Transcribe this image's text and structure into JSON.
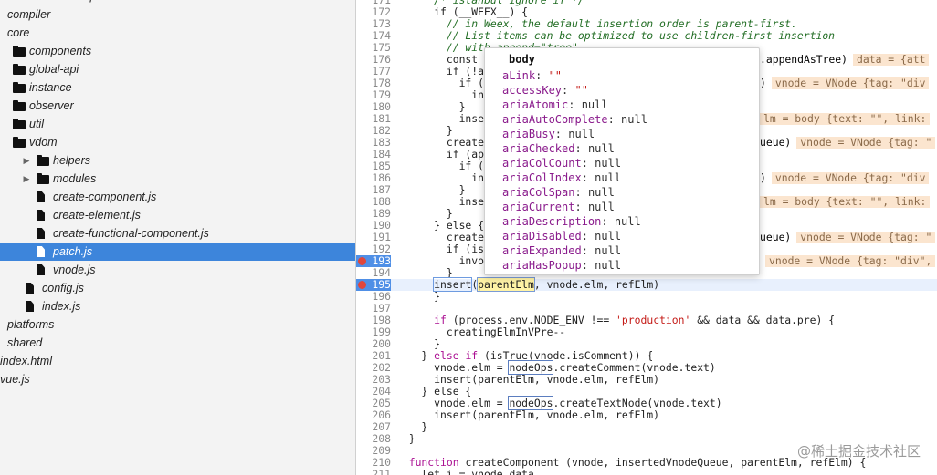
{
  "sidebar": {
    "items": [
      {
        "label": "Users/tian/Desktop/read-source/vue/src",
        "type": "root",
        "depth": 0
      },
      {
        "label": "compiler",
        "type": "folder",
        "depth": 0
      },
      {
        "label": "core",
        "type": "folder-open",
        "depth": 0
      },
      {
        "label": "components",
        "type": "folder",
        "depth": 1
      },
      {
        "label": "global-api",
        "type": "folder",
        "depth": 1
      },
      {
        "label": "instance",
        "type": "folder",
        "depth": 1
      },
      {
        "label": "observer",
        "type": "folder",
        "depth": 1
      },
      {
        "label": "util",
        "type": "folder",
        "depth": 1
      },
      {
        "label": "vdom",
        "type": "folder",
        "depth": 1
      },
      {
        "label": "helpers",
        "type": "folder-collapsed",
        "depth": 2
      },
      {
        "label": "modules",
        "type": "folder-collapsed",
        "depth": 2
      },
      {
        "label": "create-component.js",
        "type": "file",
        "depth": 2
      },
      {
        "label": "create-element.js",
        "type": "file",
        "depth": 2
      },
      {
        "label": "create-functional-component.js",
        "type": "file",
        "depth": 2
      },
      {
        "label": "patch.js",
        "type": "file",
        "depth": 2,
        "selected": true
      },
      {
        "label": "vnode.js",
        "type": "file",
        "depth": 2
      },
      {
        "label": "config.js",
        "type": "file",
        "depth": 1
      },
      {
        "label": "index.js",
        "type": "file",
        "depth": 1
      },
      {
        "label": "platforms",
        "type": "folder",
        "depth": 0
      },
      {
        "label": "shared",
        "type": "folder",
        "depth": 0
      },
      {
        "label": "index.html",
        "type": "file-noicon",
        "depth": 0
      },
      {
        "label": "vue.js",
        "type": "file-noicon",
        "depth": 0
      }
    ]
  },
  "editor": {
    "lines": [
      {
        "n": "171",
        "t": "      /* istanbul ignore if */",
        "c": "cmt"
      },
      {
        "n": "172",
        "t": "      if (__WEEX__) {"
      },
      {
        "n": "173",
        "t": "        // in Weex, the default insertion order is parent-first.",
        "c": "cmt"
      },
      {
        "n": "174",
        "t": "        // List items can be optimized to use children-first insertion",
        "c": "cmt"
      },
      {
        "n": "175",
        "t": "        // with append=\"tree\".",
        "c": "cmt"
      },
      {
        "n": "176",
        "t": "        const",
        "tail": ".appendAsTree)",
        "inline": "data = {att"
      },
      {
        "n": "177",
        "t": "        if (!a"
      },
      {
        "n": "178",
        "t": "          if (",
        "tail": ")",
        "inline": "vnode = VNode {tag: \"div"
      },
      {
        "n": "179",
        "t": "            in"
      },
      {
        "n": "180",
        "t": "          }"
      },
      {
        "n": "181",
        "t": "          inse",
        "tail": "lm = body {text: \"\", link:",
        "tailinl": true
      },
      {
        "n": "182",
        "t": "        }"
      },
      {
        "n": "183",
        "t": "        create",
        "tail": "ueue)",
        "inline": "vnode = VNode {tag: \""
      },
      {
        "n": "184",
        "t": "        if (ap"
      },
      {
        "n": "185",
        "t": "          if ("
      },
      {
        "n": "186",
        "t": "            in",
        "tail": ")",
        "inline": "vnode = VNode {tag: \"div"
      },
      {
        "n": "187",
        "t": "          }"
      },
      {
        "n": "188",
        "t": "          inse",
        "tail": "lm = body {text: \"\", link:",
        "tailinl": true
      },
      {
        "n": "189",
        "t": "        }"
      },
      {
        "n": "190",
        "t": "      } else {"
      },
      {
        "n": "191",
        "t": "        create",
        "tail": "ueue)",
        "inline": "vnode = VNode {tag: \""
      },
      {
        "n": "192",
        "t": "        if (is"
      },
      {
        "n": "193",
        "t": "          invo",
        "bp": true,
        "tail": "",
        "inline": "vnode = VNode {tag: \"div\","
      },
      {
        "n": "194",
        "t": "        }"
      },
      {
        "n": "195",
        "cur": true,
        "bp": true,
        "t": ""
      },
      {
        "n": "196",
        "t": "      }"
      },
      {
        "n": "197",
        "t": ""
      },
      {
        "n": "198",
        "t": "",
        "special": "l198"
      },
      {
        "n": "199",
        "t": "        creatingElmInVPre--"
      },
      {
        "n": "200",
        "t": "      }"
      },
      {
        "n": "201",
        "t": "",
        "special": "l201"
      },
      {
        "n": "202",
        "t": "",
        "special": "l202"
      },
      {
        "n": "203",
        "t": "      insert(parentElm, vnode.elm, refElm)"
      },
      {
        "n": "204",
        "t": "    } else {"
      },
      {
        "n": "205",
        "t": "",
        "special": "l205"
      },
      {
        "n": "206",
        "t": "      insert(parentElm, vnode.elm, refElm)"
      },
      {
        "n": "207",
        "t": "    }"
      },
      {
        "n": "208",
        "t": "  }"
      },
      {
        "n": "209",
        "t": ""
      },
      {
        "n": "210",
        "t": "",
        "special": "l210"
      },
      {
        "n": "211",
        "t": "    let i = vnode.data"
      }
    ],
    "line195": {
      "a": "      ",
      "b": "insert",
      "c": "(",
      "d": "parentElm",
      "e": ", vnode.elm, refElm)"
    },
    "l198": {
      "a": "      ",
      "kw": "if",
      "b": " (process.env.NODE_ENV !== ",
      "s": "'production'",
      "c": " && data && data.pre) {"
    },
    "l201": {
      "a": "    } ",
      "kw": "else if",
      "b": " (isTrue(vnode.isComment)) {"
    },
    "l202": {
      "a": "      vnode.elm = ",
      "box": "nodeOps",
      "b": ".createComment(vnode.text)"
    },
    "l205": {
      "a": "      vnode.elm = ",
      "box": "nodeOps",
      "b": ".createTextNode(vnode.text)"
    },
    "l210": {
      "a": "  ",
      "kw": "function",
      "b": " createComponent (vnode, insertedVnodeQueue, parentElm, refElm) {"
    }
  },
  "popover": {
    "title": "body",
    "props": [
      {
        "k": "aLink",
        "v": "\"\"",
        "str": true
      },
      {
        "k": "accessKey",
        "v": "\"\"",
        "str": true
      },
      {
        "k": "ariaAtomic",
        "v": "null"
      },
      {
        "k": "ariaAutoComplete",
        "v": "null"
      },
      {
        "k": "ariaBusy",
        "v": "null"
      },
      {
        "k": "ariaChecked",
        "v": "null"
      },
      {
        "k": "ariaColCount",
        "v": "null"
      },
      {
        "k": "ariaColIndex",
        "v": "null"
      },
      {
        "k": "ariaColSpan",
        "v": "null"
      },
      {
        "k": "ariaCurrent",
        "v": "null"
      },
      {
        "k": "ariaDescription",
        "v": "null"
      },
      {
        "k": "ariaDisabled",
        "v": "null"
      },
      {
        "k": "ariaExpanded",
        "v": "null"
      },
      {
        "k": "ariaHasPopup",
        "v": "null"
      }
    ]
  },
  "watermark": "@稀土掘金技术社区"
}
